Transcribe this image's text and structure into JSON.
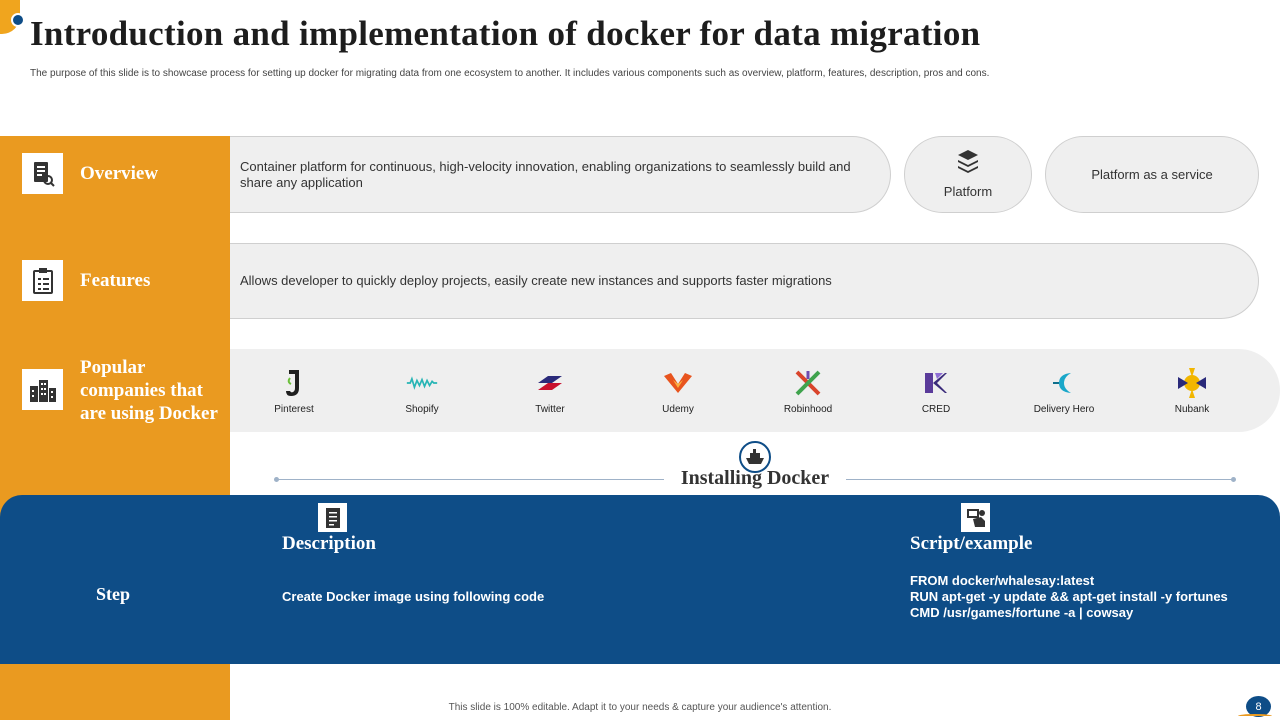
{
  "slide": {
    "title": "Introduction and implementation of  docker for data migration",
    "subtitle": "The purpose of this slide is to showcase process for setting up docker for migrating data from one ecosystem to another. It includes various components such as overview, platform, features, description, pros and cons."
  },
  "overview": {
    "label": "Overview",
    "icon": "checklist-magnifier-icon",
    "text": "Container platform for continuous, high-velocity innovation, enabling organizations to seamlessly build and share any application",
    "platform_label": "Platform",
    "platform_icon": "stacked-layers-icon",
    "paas_label": "Platform as a service"
  },
  "features": {
    "label": "Features",
    "icon": "clipboard-icon",
    "text": "Allows developer  to quickly deploy projects, easily create new instances and supports faster migrations"
  },
  "companies": {
    "label": "Popular companies that are using Docker",
    "icon": "buildings-icon",
    "items": [
      {
        "name": "Pinterest",
        "icon": "pinterest-logo-icon",
        "color": "#1f1f1f"
      },
      {
        "name": "Shopify",
        "icon": "shopify-logo-icon",
        "color": "#27b5b5"
      },
      {
        "name": "Twitter",
        "icon": "twitter-logo-icon",
        "color": "#c8102e"
      },
      {
        "name": "Udemy",
        "icon": "udemy-logo-icon",
        "color": "#e8541e"
      },
      {
        "name": "Robinhood",
        "icon": "robinhood-logo-icon",
        "color": "#6e4bb0"
      },
      {
        "name": "CRED",
        "icon": "cred-logo-icon",
        "color": "#5a3b9a"
      },
      {
        "name": "Delivery Hero",
        "icon": "delivery-hero-logo-icon",
        "color": "#1aa7c9"
      },
      {
        "name": "Nubank",
        "icon": "nubank-logo-icon",
        "color": "#f2b600"
      }
    ]
  },
  "installing": {
    "title": "Installing Docker",
    "icon": "ship-icon",
    "step_label": "Step",
    "description_head": "Description",
    "description_icon": "document-icon",
    "description_text": "Create Docker image using following code",
    "script_head": "Script/example",
    "script_icon": "code-hands-icon",
    "script_lines": [
      "FROM docker/whalesay:latest",
      "RUN  apt-get -y update && apt-get install -y fortunes",
      "CMD /usr/games/fortune -a | cowsay"
    ]
  },
  "footer": {
    "text": "This slide is 100% editable.  Adapt it to your needs & capture your audience's attention.",
    "page_number": "8"
  },
  "colors": {
    "accent_orange": "#EA9A20",
    "accent_blue": "#0E4D87",
    "pill_gray": "#EFEFEF"
  }
}
